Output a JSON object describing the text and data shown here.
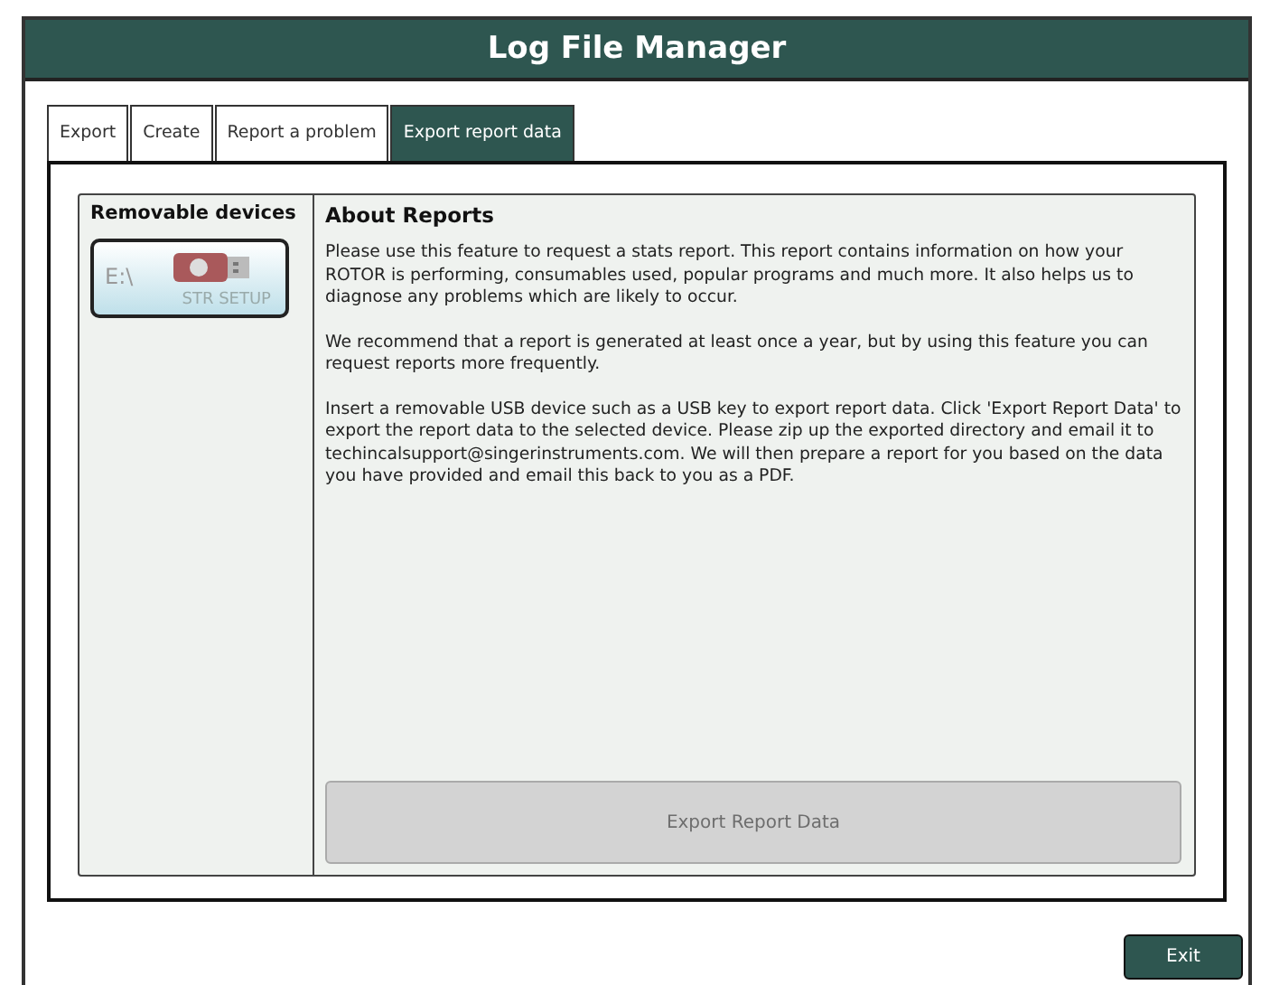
{
  "window": {
    "title": "Log File Manager"
  },
  "tabs": [
    {
      "label": "Export",
      "selected": false
    },
    {
      "label": "Create",
      "selected": false
    },
    {
      "label": "Report a problem",
      "selected": false
    },
    {
      "label": "Export report data",
      "selected": true
    }
  ],
  "devices": {
    "heading": "Removable devices",
    "items": [
      {
        "drive": "E:\\",
        "name": "STR SETUP",
        "selected": true
      }
    ]
  },
  "about": {
    "heading": "About Reports",
    "paragraphs": [
      "Please use this feature to request a stats report. This report contains information on how your ROTOR is performing, consumables used, popular programs and much more. It also helps us to diagnose any problems which are likely to occur.",
      "We recommend that a report is generated at least once a year, but by using this feature you can request reports more frequently.",
      "Insert a removable USB device such as a USB key to export report data. Click 'Export Report Data' to export the report data to the selected device. Please zip up the exported directory and email it to techincalsupport@singerinstruments.com. We will then prepare a report for you based on the data you have provided and email this back to you as a PDF."
    ],
    "button": {
      "label": "Export Report Data",
      "disabled": true
    }
  },
  "buttons": [
    {
      "label": "Exit"
    }
  ]
}
